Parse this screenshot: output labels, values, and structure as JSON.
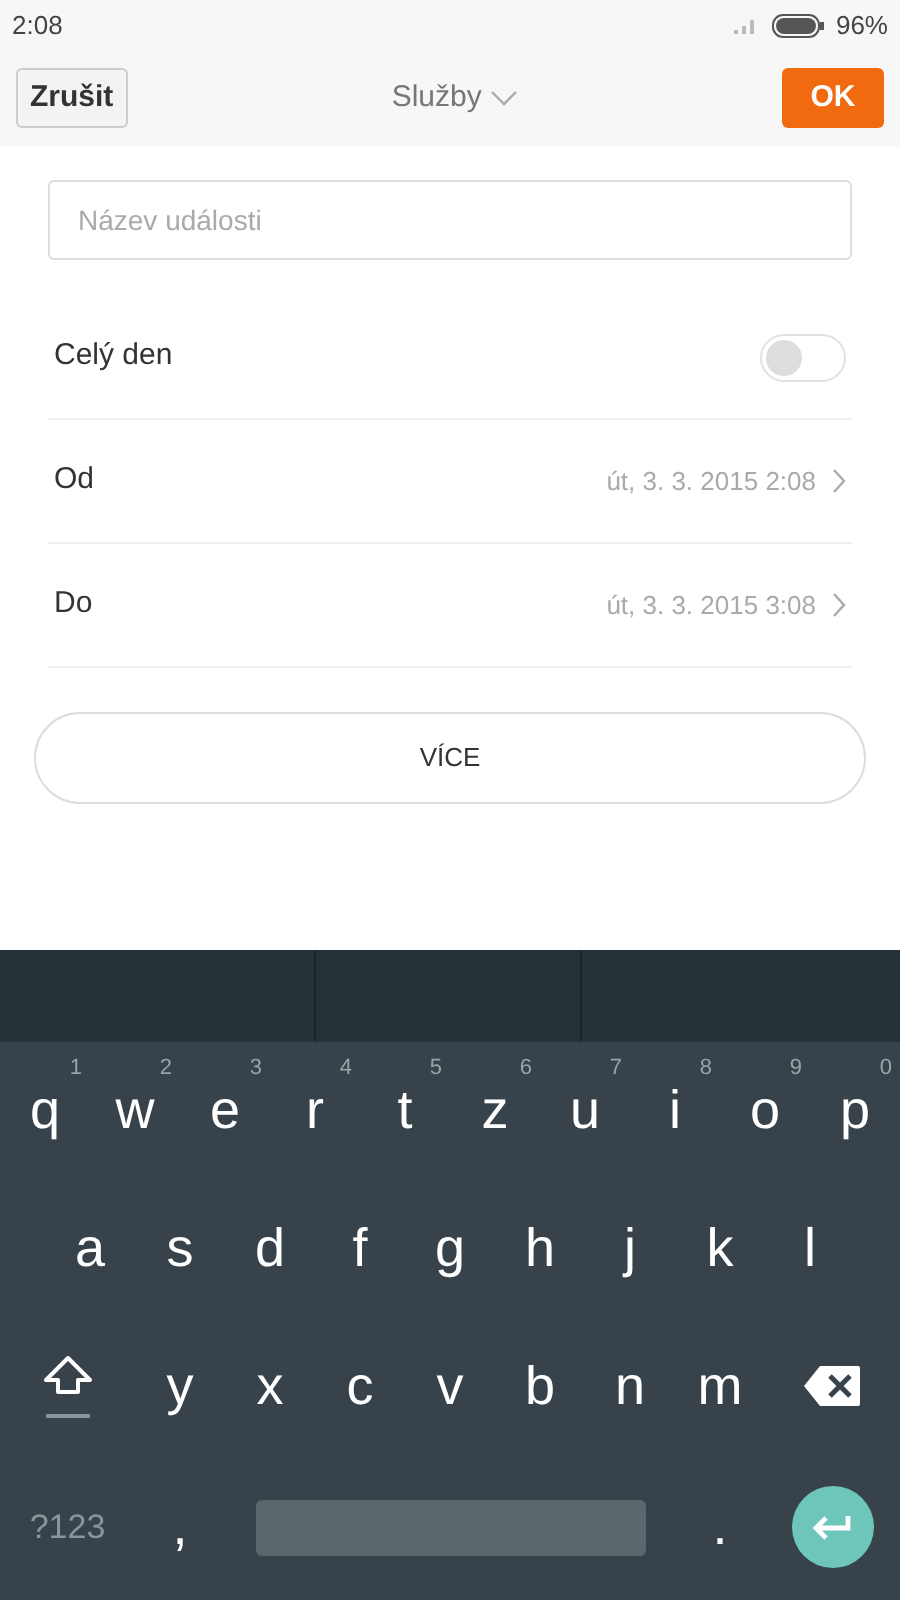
{
  "status_bar": {
    "time": "2:08",
    "battery": "96%"
  },
  "header": {
    "cancel": "Zrušit",
    "title": "Služby",
    "ok": "OK"
  },
  "title_field": {
    "placeholder": "Název události"
  },
  "rows": [
    {
      "kind": "toggle",
      "label": "Celý den",
      "on": false
    },
    {
      "kind": "datetime",
      "label": "Od",
      "value": "út, 3. 3. 2015 2:08"
    },
    {
      "kind": "datetime",
      "label": "Do",
      "value": "út, 3. 3. 2015 3:08"
    }
  ],
  "more_button": "VÍCE",
  "keyboard": {
    "row_1": [
      {
        "key": "q",
        "hint": "1"
      },
      {
        "key": "w",
        "hint": "2"
      },
      {
        "key": "e",
        "hint": "3"
      },
      {
        "key": "r",
        "hint": "4"
      },
      {
        "key": "t",
        "hint": "5"
      },
      {
        "key": "z",
        "hint": "6"
      },
      {
        "key": "u",
        "hint": "7"
      },
      {
        "key": "i",
        "hint": "8"
      },
      {
        "key": "o",
        "hint": "9"
      },
      {
        "key": "p",
        "hint": "0"
      }
    ],
    "row_2": [
      "a",
      "s",
      "d",
      "f",
      "g",
      "h",
      "j",
      "k",
      "l"
    ],
    "row_3": [
      "y",
      "x",
      "c",
      "v",
      "b",
      "n",
      "m"
    ],
    "symbols_key": "?123",
    "comma_key": ",",
    "period_key": "."
  }
}
